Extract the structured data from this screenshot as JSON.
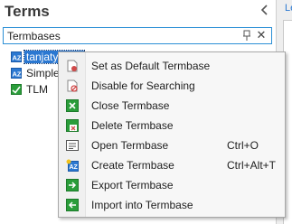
{
  "panel": {
    "title": "Terms",
    "collapse_icon": "chevron-left-icon"
  },
  "combo": {
    "value": "Termbases",
    "pin_icon": "pin-icon",
    "close_icon": "close-icon"
  },
  "termbases": [
    {
      "label": "tanjatybring",
      "selected": true,
      "icon": "termbase-icon"
    },
    {
      "label": "Simple",
      "selected": false,
      "icon": "termbase-icon"
    },
    {
      "label": "TLM",
      "selected": false,
      "icon": "termbase-green-icon"
    }
  ],
  "right_panel": {
    "label": "Le"
  },
  "context_menu": {
    "items": [
      {
        "label": "Set as Default Termbase",
        "shortcut": "",
        "icon": "default-termbase-icon"
      },
      {
        "label": "Disable for Searching",
        "shortcut": "",
        "icon": "disable-search-icon"
      },
      {
        "label": "Close Termbase",
        "shortcut": "",
        "icon": "close-termbase-icon"
      },
      {
        "label": "Delete Termbase",
        "shortcut": "",
        "icon": "delete-termbase-icon"
      },
      {
        "label": "Open Termbase",
        "shortcut": "Ctrl+O",
        "icon": "open-termbase-icon"
      },
      {
        "label": "Create Termbase",
        "shortcut": "Ctrl+Alt+T",
        "icon": "create-termbase-icon"
      },
      {
        "label": "Export Termbase",
        "shortcut": "",
        "icon": "export-termbase-icon"
      },
      {
        "label": "Import into Termbase",
        "shortcut": "",
        "icon": "import-termbase-icon"
      }
    ]
  },
  "colors": {
    "selection": "#2b78d1",
    "combo_border": "#2b8fd6",
    "icon_green": "#2a9d3a",
    "icon_blue": "#2b78d1"
  }
}
